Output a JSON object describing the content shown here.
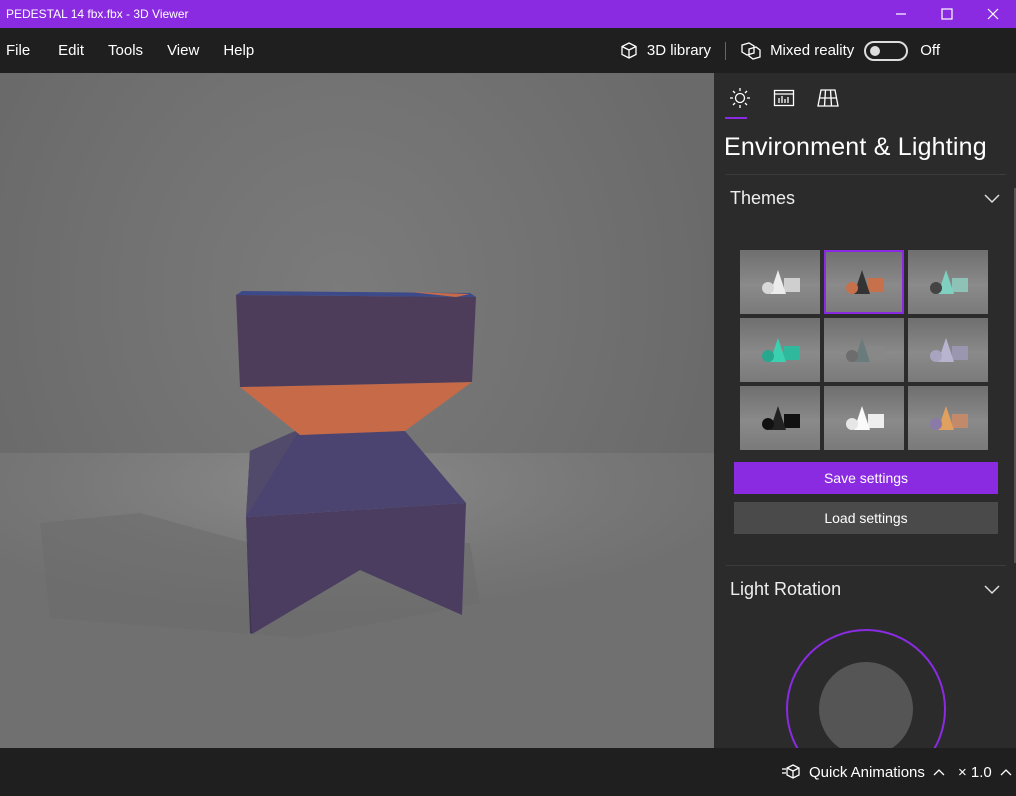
{
  "window": {
    "title": "PEDESTAL 14 fbx.fbx - 3D Viewer"
  },
  "menu": {
    "items": [
      "File",
      "Edit",
      "Tools",
      "View",
      "Help"
    ],
    "library_label": "3D library",
    "mixed_reality_label": "Mixed reality",
    "toggle_state": "Off"
  },
  "panel": {
    "tabs": [
      {
        "icon": "sun-icon",
        "active": true
      },
      {
        "icon": "stats-icon",
        "active": false
      },
      {
        "icon": "grid-icon",
        "active": false
      }
    ],
    "title": "Environment & Lighting",
    "themes_label": "Themes",
    "save_label": "Save settings",
    "load_label": "Load settings",
    "light_rotation_label": "Light Rotation",
    "selected_theme": 2
  },
  "status": {
    "quick_animations_label": "Quick Animations",
    "speed_label": "× 1.0"
  },
  "colors": {
    "accent": "#8a2be2",
    "model_body": "#4b3d5e",
    "model_accent": "#c46a4a"
  }
}
